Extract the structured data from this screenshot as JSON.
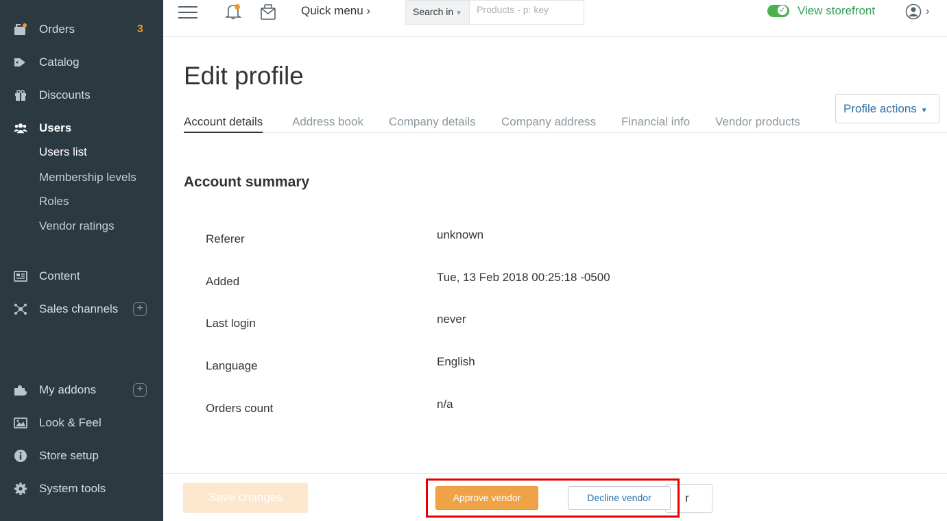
{
  "sidebar": {
    "orders": {
      "label": "Orders",
      "badge": "3",
      "icon": "orders-icon"
    },
    "catalog": {
      "label": "Catalog",
      "icon": "tag-icon"
    },
    "discounts": {
      "label": "Discounts",
      "icon": "gift-icon"
    },
    "users": {
      "label": "Users",
      "icon": "users-icon"
    },
    "users_sub": [
      "Users list",
      "Membership levels",
      "Roles",
      "Vendor ratings"
    ],
    "content": {
      "label": "Content",
      "icon": "content-icon"
    },
    "sales_channels": {
      "label": "Sales channels",
      "icon": "sales-channels-icon"
    },
    "my_addons": {
      "label": "My addons",
      "icon": "puzzle-icon"
    },
    "look_feel": {
      "label": "Look & Feel",
      "icon": "image-icon"
    },
    "store_setup": {
      "label": "Store setup",
      "icon": "info-icon"
    },
    "system_tools": {
      "label": "System tools",
      "icon": "gear-icon"
    }
  },
  "topbar": {
    "quick_menu": "Quick menu ›",
    "search_in": "Search in",
    "search_placeholder": "Products - p: key",
    "view_storefront": "View storefront",
    "user_chevron": "›"
  },
  "page": {
    "title": "Edit profile",
    "profile_actions": "Profile actions",
    "tabs": [
      "Account details",
      "Address book",
      "Company details",
      "Company address",
      "Financial info",
      "Vendor products"
    ],
    "section_title": "Account summary",
    "summary": [
      {
        "label": "Referer",
        "value": "unknown"
      },
      {
        "label": "Added",
        "value": "Tue, 13 Feb 2018 00:25:18 -0500"
      },
      {
        "label": "Last login",
        "value": "never"
      },
      {
        "label": "Language",
        "value": "English"
      },
      {
        "label": "Orders count",
        "value": "n/a"
      }
    ]
  },
  "actions": {
    "save": "Save changes",
    "approve": "Approve vendor",
    "decline": "Decline vendor",
    "partial": "r"
  },
  "colors": {
    "sidebar_bg": "#2b3a40",
    "accent_orange": "#f29432",
    "storefront_green": "#2d9f56",
    "link_blue": "#2a6fa8",
    "highlight_red": "#e30000"
  }
}
